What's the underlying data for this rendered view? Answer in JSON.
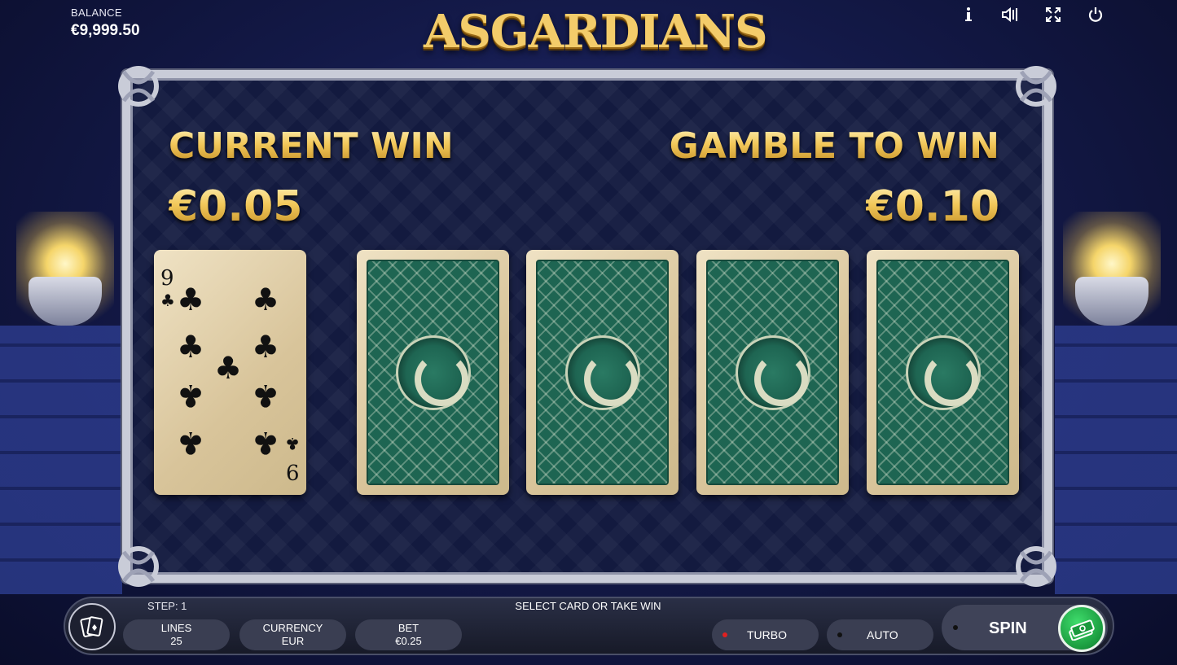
{
  "game": {
    "title": "ASGARDIANS"
  },
  "balance": {
    "label": "BALANCE",
    "value": "€9,999.50"
  },
  "top_icons": [
    "info-icon",
    "sound-icon",
    "fullscreen-icon",
    "power-icon"
  ],
  "gamble": {
    "current_win_label": "CURRENT WIN",
    "current_win_value": "€0.05",
    "gamble_to_win_label": "GAMBLE TO WIN",
    "gamble_to_win_value": "€0.10",
    "dealer_card": {
      "rank": "9",
      "suit": "♣"
    },
    "face_down_cards": 4
  },
  "bottom_bar": {
    "step": "STEP: 1",
    "message": "SELECT CARD OR TAKE WIN",
    "lines_label": "LINES",
    "lines_value": "25",
    "currency_label": "CURRENCY",
    "currency_value": "EUR",
    "bet_label": "BET",
    "bet_value": "€0.25",
    "turbo_label": "TURBO",
    "auto_label": "AUTO",
    "spin_label": "SPIN"
  },
  "colors": {
    "gold": "#f2c85a",
    "card_back": "#1e6552",
    "take_win_green": "#1a9a3e",
    "turbo_dot": "#e02020"
  }
}
